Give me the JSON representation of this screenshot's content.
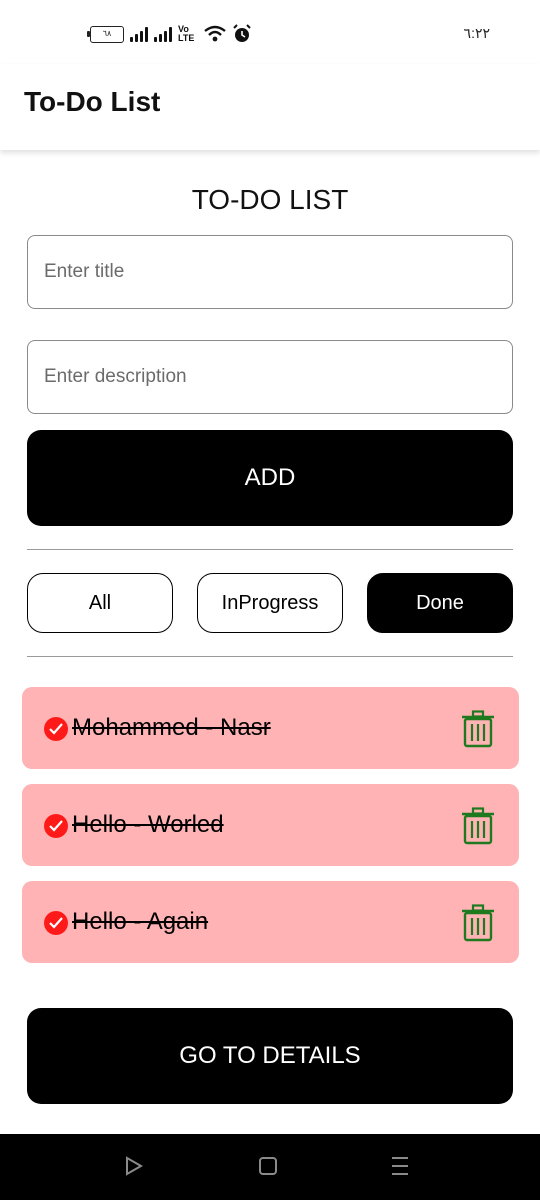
{
  "status_bar": {
    "battery_text": "٦٨",
    "time": "٦:٢٢",
    "icons": [
      "battery-icon",
      "signal-icon",
      "signal-icon",
      "volte-icon",
      "wifi-icon",
      "alarm-icon"
    ],
    "volte_text": "Vo LTE"
  },
  "app_bar": {
    "title": "To-Do List"
  },
  "main": {
    "heading": "TO-DO LIST",
    "title_placeholder": "Enter title",
    "description_placeholder": "Enter description",
    "add_label": "ADD",
    "filters": [
      {
        "label": "All",
        "active": false
      },
      {
        "label": "InProgress",
        "active": false
      },
      {
        "label": "Done",
        "active": true
      }
    ],
    "tasks": [
      {
        "text": "Mohammed - Nasr",
        "done": true
      },
      {
        "text": "Hello - Worled",
        "done": true
      },
      {
        "text": "Hello - Again",
        "done": true
      }
    ],
    "details_label": "GO TO DETAILS"
  },
  "nav_bar": {
    "icons": [
      "back-icon",
      "home-icon",
      "menu-icon"
    ]
  },
  "colors": {
    "task_background": "#ffb3b5",
    "check_red": "#ff1a1a",
    "delete_green": "#1f7a1f",
    "button_black": "#000000"
  }
}
